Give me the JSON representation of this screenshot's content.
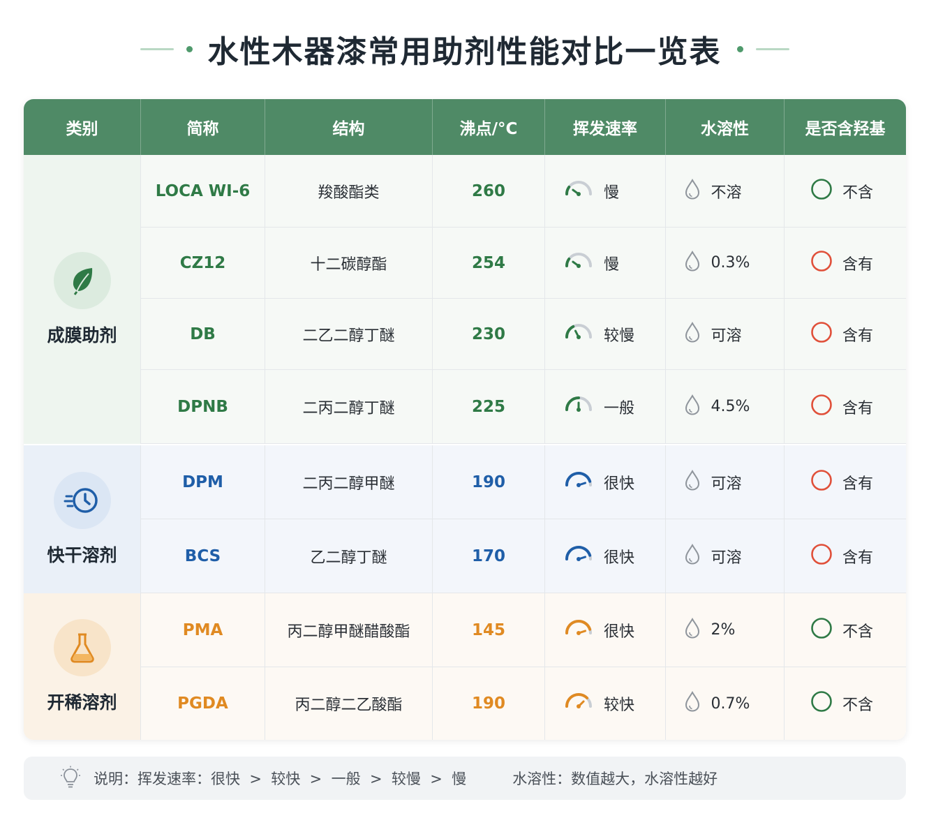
{
  "title": "水性木器漆常用助剂性能对比一览表",
  "headers": [
    "类别",
    "简称",
    "结构",
    "沸点/°C",
    "挥发速率",
    "水溶性",
    "是否含羟基"
  ],
  "groups": [
    {
      "name": "成膜助剂",
      "icon": "leaf-icon",
      "color": "#2f7a46",
      "rows": [
        {
          "abbr": "LOCA WI-6",
          "structure": "羧酸酯类",
          "bp": "260",
          "rate": "慢",
          "rate_level": 0.2,
          "solubility": "不溶",
          "hydroxyl": "不含",
          "hydroxyl_color": "#2f7a46"
        },
        {
          "abbr": "CZ12",
          "structure": "十二碳醇酯",
          "bp": "254",
          "rate": "慢",
          "rate_level": 0.2,
          "solubility": "0.3%",
          "hydroxyl": "含有",
          "hydroxyl_color": "#e0503a"
        },
        {
          "abbr": "DB",
          "structure": "二乙二醇丁醚",
          "bp": "230",
          "rate": "较慢",
          "rate_level": 0.35,
          "solubility": "可溶",
          "hydroxyl": "含有",
          "hydroxyl_color": "#e0503a"
        },
        {
          "abbr": "DPNB",
          "structure": "二丙二醇丁醚",
          "bp": "225",
          "rate": "一般",
          "rate_level": 0.5,
          "solubility": "4.5%",
          "hydroxyl": "含有",
          "hydroxyl_color": "#e0503a"
        }
      ]
    },
    {
      "name": "快干溶剂",
      "icon": "fast-clock-icon",
      "color": "#1f5ea8",
      "rows": [
        {
          "abbr": "DPM",
          "structure": "二丙二醇甲醚",
          "bp": "190",
          "rate": "很快",
          "rate_level": 0.9,
          "solubility": "可溶",
          "hydroxyl": "含有",
          "hydroxyl_color": "#e0503a"
        },
        {
          "abbr": "BCS",
          "structure": "乙二醇丁醚",
          "bp": "170",
          "rate": "很快",
          "rate_level": 0.9,
          "solubility": "可溶",
          "hydroxyl": "含有",
          "hydroxyl_color": "#e0503a"
        }
      ]
    },
    {
      "name": "开稀溶剂",
      "icon": "flask-icon",
      "color": "#e08a22",
      "rows": [
        {
          "abbr": "PMA",
          "structure": "丙二醇甲醚醋酸酯",
          "bp": "145",
          "rate": "很快",
          "rate_level": 0.9,
          "solubility": "2%",
          "hydroxyl": "不含",
          "hydroxyl_color": "#2f7a46"
        },
        {
          "abbr": "PGDA",
          "structure": "丙二醇二乙酸酯",
          "bp": "190",
          "rate": "较快",
          "rate_level": 0.75,
          "solubility": "0.7%",
          "hydroxyl": "不含",
          "hydroxyl_color": "#2f7a46"
        }
      ]
    }
  ],
  "note": {
    "legend": "说明：挥发速率：很快  >  较快  >  一般  >  较慢  >  慢",
    "water": "水溶性：数值越大，水溶性越好",
    "icon": "lightbulb-icon"
  }
}
